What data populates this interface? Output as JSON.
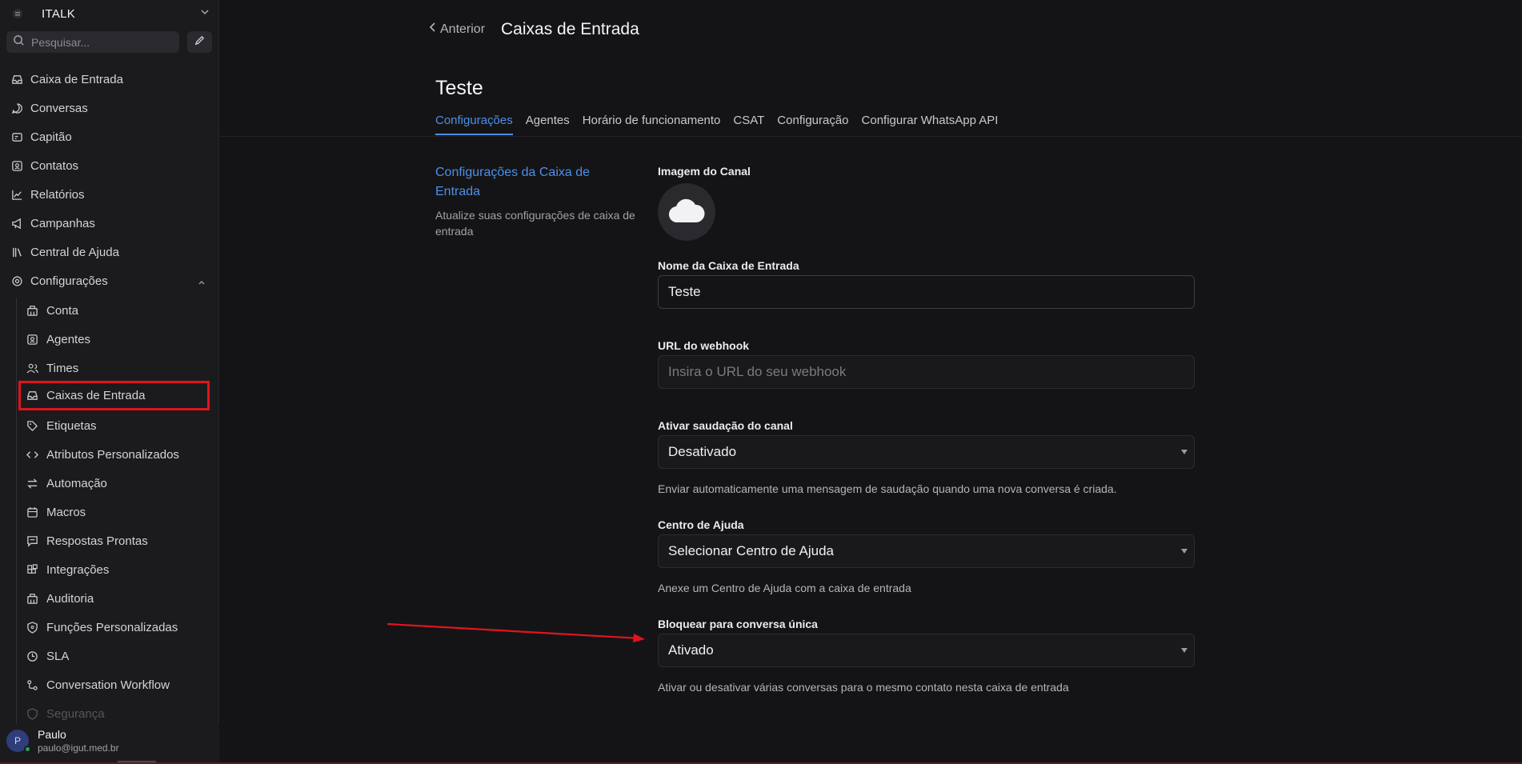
{
  "sidebar": {
    "workspace_name": "ITALK",
    "search_placeholder": "Pesquisar...",
    "items": [
      {
        "label": "Caixa de Entrada"
      },
      {
        "label": "Conversas"
      },
      {
        "label": "Capitão"
      },
      {
        "label": "Contatos"
      },
      {
        "label": "Relatórios"
      },
      {
        "label": "Campanhas"
      },
      {
        "label": "Central de Ajuda"
      },
      {
        "label": "Configurações"
      }
    ],
    "settings_items": [
      {
        "label": "Conta"
      },
      {
        "label": "Agentes"
      },
      {
        "label": "Times"
      },
      {
        "label": "Caixas de Entrada"
      },
      {
        "label": "Etiquetas"
      },
      {
        "label": "Atributos Personalizados"
      },
      {
        "label": "Automação"
      },
      {
        "label": "Macros"
      },
      {
        "label": "Respostas Prontas"
      },
      {
        "label": "Integrações"
      },
      {
        "label": "Auditoria"
      },
      {
        "label": "Funções Personalizadas"
      },
      {
        "label": "SLA"
      },
      {
        "label": "Conversation Workflow"
      },
      {
        "label": "Segurança"
      }
    ],
    "user": {
      "initial": "P",
      "name": "Paulo",
      "email": "paulo@igut.med.br"
    }
  },
  "header": {
    "back_label": "Anterior",
    "title": "Caixas de Entrada"
  },
  "inbox": {
    "name": "Teste",
    "tabs": [
      {
        "label": "Configurações"
      },
      {
        "label": "Agentes"
      },
      {
        "label": "Horário de funcionamento"
      },
      {
        "label": "CSAT"
      },
      {
        "label": "Configuração"
      },
      {
        "label": "Configurar WhatsApp API"
      }
    ]
  },
  "section": {
    "title": "Configurações da Caixa de Entrada",
    "description": "Atualize suas configurações de caixa de entrada"
  },
  "form": {
    "channel_image_label": "Imagem do Canal",
    "inbox_name_label": "Nome da Caixa de Entrada",
    "inbox_name_value": "Teste",
    "webhook_label": "URL do webhook",
    "webhook_placeholder": "Insira o URL do seu webhook",
    "greeting_label": "Ativar saudação do canal",
    "greeting_value": "Desativado",
    "greeting_help": "Enviar automaticamente uma mensagem de saudação quando uma nova conversa é criada.",
    "help_center_label": "Centro de Ajuda",
    "help_center_value": "Selecionar Centro de Ajuda",
    "help_center_help": "Anexe um Centro de Ajuda com a caixa de entrada",
    "lock_label": "Bloquear para conversa única",
    "lock_value": "Ativado",
    "lock_help": "Ativar ou desativar várias conversas para o mesmo contato nesta caixa de entrada"
  },
  "colors": {
    "accent": "#4d8fe8",
    "annotation": "#e0141c",
    "background": "#141416",
    "sidebar": "#1b1b1e"
  }
}
